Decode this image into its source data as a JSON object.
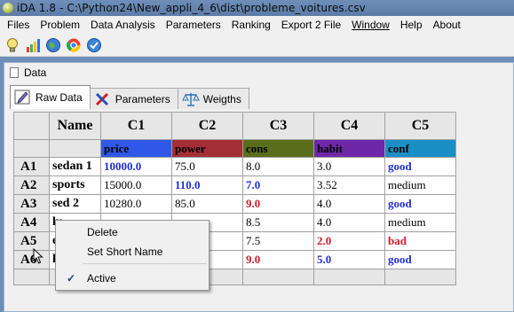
{
  "window": {
    "title": "iDA 1.8 - C:\\Python24\\New_appli_4_6\\dist\\probleme_voitures.csv"
  },
  "menu": [
    {
      "label": "Files"
    },
    {
      "label": "Problem"
    },
    {
      "label": "Data Analysis"
    },
    {
      "label": "Parameters"
    },
    {
      "label": "Ranking"
    },
    {
      "label": "Export 2 File"
    },
    {
      "label": "Window"
    },
    {
      "label": "Help"
    },
    {
      "label": "About"
    }
  ],
  "toolbar": {
    "icons": [
      "lightbulb-icon",
      "bar-chart-icon",
      "globe-icon",
      "chrome-icon",
      "checkmark-icon"
    ]
  },
  "inner_window": {
    "title": "Data"
  },
  "tabs": [
    {
      "label": "Raw Data",
      "icon": "edit-icon"
    },
    {
      "label": "Parameters",
      "icon": "tools-icon"
    },
    {
      "label": "Weigths",
      "icon": "scale-icon"
    }
  ],
  "table": {
    "name_header": "Name",
    "columns": [
      {
        "code": "C1",
        "criterion": "price",
        "color": "#2f57e8"
      },
      {
        "code": "C2",
        "criterion": "power",
        "color": "#a32e36"
      },
      {
        "code": "C3",
        "criterion": "cons",
        "color": "#5a6d1b"
      },
      {
        "code": "C4",
        "criterion": "habit",
        "color": "#6e27a6"
      },
      {
        "code": "C5",
        "criterion": "conf",
        "color": "#1a8fc6"
      }
    ],
    "rows": [
      {
        "id": "A1",
        "name": "sedan 1",
        "c1": "10000.0",
        "c2": "75.0",
        "c3": "8.0",
        "c4": "3.0",
        "c5": "good"
      },
      {
        "id": "A2",
        "name": "sports",
        "c1": "15000.0",
        "c2": "110.0",
        "c3": "7.0",
        "c4": "3.52",
        "c5": "medium"
      },
      {
        "id": "A3",
        "name": "sed 2",
        "c1": "10280.0",
        "c2": "85.0",
        "c3": "9.0",
        "c4": "4.0",
        "c5": "good"
      },
      {
        "id": "A4",
        "name": "lu",
        "c1": "",
        "c2": "",
        "c3": "8.5",
        "c4": "4.0",
        "c5": "medium"
      },
      {
        "id": "A5",
        "name": "e",
        "c1": "",
        "c2": "",
        "c3": "7.5",
        "c4": "2.0",
        "c5": "bad"
      },
      {
        "id": "A6",
        "name": "lu",
        "c1": "",
        "c2": "",
        "c3": "9.0",
        "c4": "5.0",
        "c5": "good"
      }
    ],
    "colors": {
      "blue": "#1f2fd6",
      "red": "#d8192b"
    }
  },
  "context_menu": {
    "items": [
      {
        "label": "Delete"
      },
      {
        "label": "Set Short Name"
      },
      {
        "label": "Active",
        "checked": true
      }
    ]
  }
}
